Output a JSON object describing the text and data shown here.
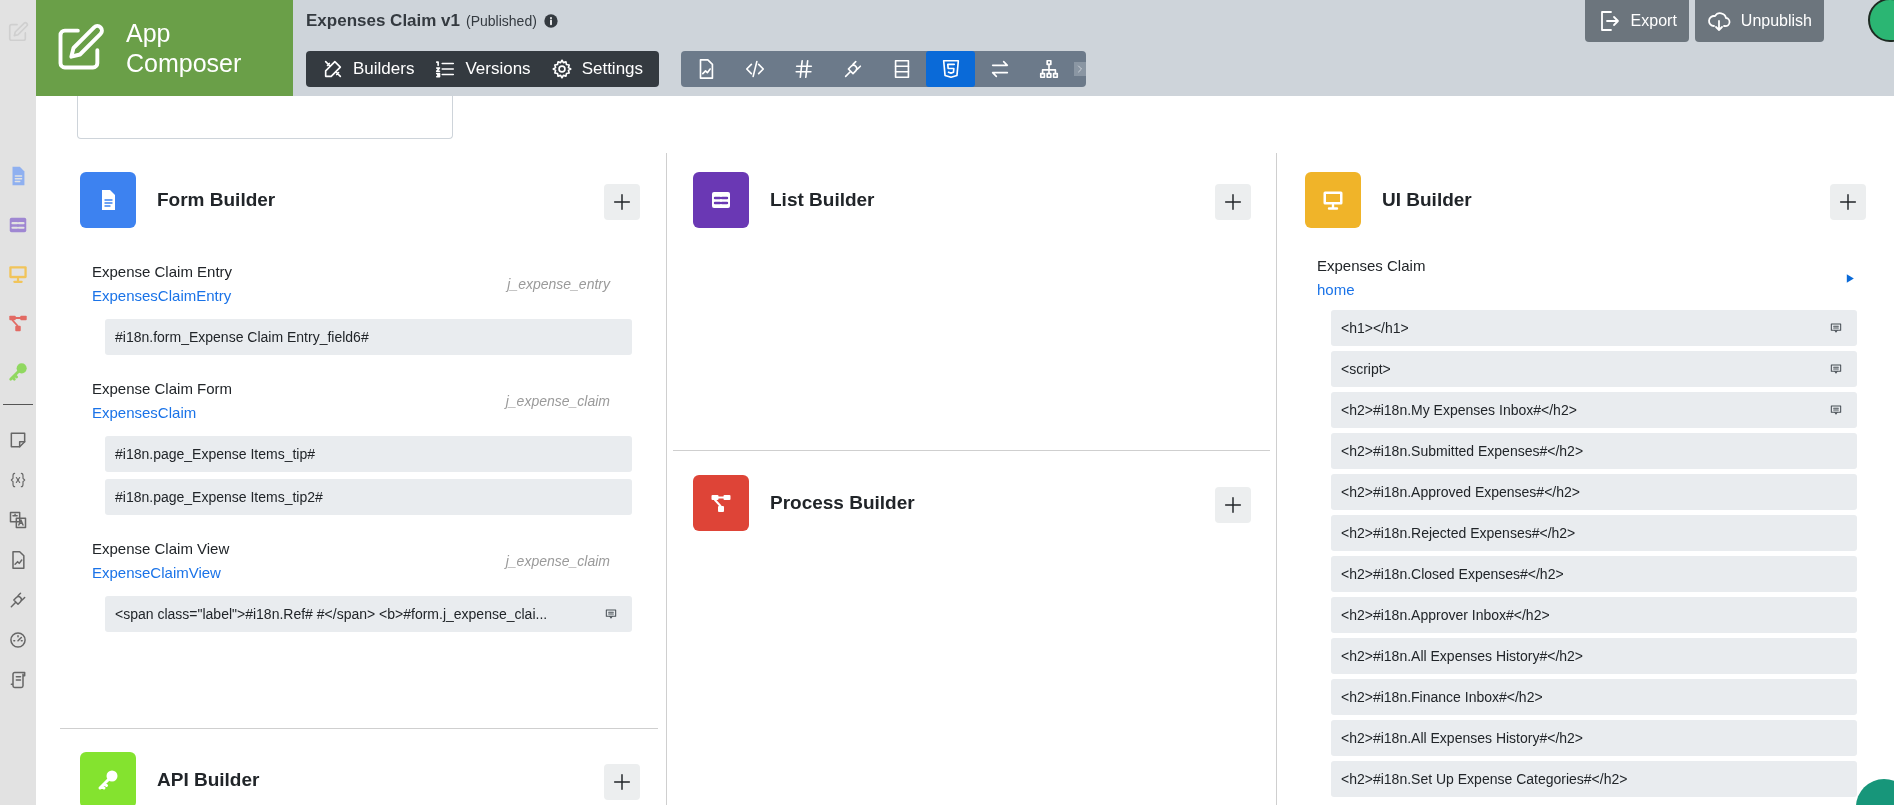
{
  "app": {
    "logo_text": "App Composer",
    "title": "Expenses Claim v1",
    "status": "(Published)"
  },
  "nav": [
    {
      "label": "Builders"
    },
    {
      "label": "Versions"
    },
    {
      "label": "Settings"
    }
  ],
  "tools": [
    {
      "selected": false
    },
    {
      "selected": false
    },
    {
      "selected": false
    },
    {
      "selected": false
    },
    {
      "selected": false
    },
    {
      "selected": true
    },
    {
      "selected": false
    },
    {
      "selected": false
    }
  ],
  "actions": [
    {
      "label": "Export"
    },
    {
      "label": "Unpublish"
    }
  ],
  "form_builder": {
    "title": "Form Builder",
    "forms": [
      {
        "name": "Expense Claim Entry",
        "id": "ExpensesClaimEntry",
        "table": "j_expense_entry",
        "fields": [
          {
            "text": "#i18n.form_Expense Claim Entry_field6#",
            "has_note": false
          }
        ]
      },
      {
        "name": "Expense Claim Form",
        "id": "ExpensesClaim",
        "table": "j_expense_claim",
        "fields": [
          {
            "text": "#i18n.page_Expense Items_tip#",
            "has_note": false
          },
          {
            "text": "#i18n.page_Expense Items_tip2#",
            "has_note": false
          }
        ]
      },
      {
        "name": "Expense Claim View",
        "id": "ExpenseClaimView",
        "table": "j_expense_claim",
        "fields": [
          {
            "text": "<span class=\"label\">#i18n.Ref# #</span> <b>#form.j_expense_clai...",
            "has_note": true
          }
        ]
      }
    ]
  },
  "list_builder": {
    "title": "List Builder"
  },
  "process_builder": {
    "title": "Process Builder"
  },
  "api_builder": {
    "title": "API Builder"
  },
  "ui_builder": {
    "title": "UI Builder",
    "userview": {
      "name": "Expenses Claim",
      "id": "home",
      "elements": [
        {
          "text": "<h1></h1>",
          "has_note": true
        },
        {
          "text": "<script>",
          "has_note": true
        },
        {
          "text": "<h2>#i18n.My Expenses Inbox#</h2>",
          "has_note": true
        },
        {
          "text": "<h2>#i18n.Submitted Expenses#</h2>",
          "has_note": false
        },
        {
          "text": "<h2>#i18n.Approved Expenses#</h2>",
          "has_note": false
        },
        {
          "text": "<h2>#i18n.Rejected Expenses#</h2>",
          "has_note": false
        },
        {
          "text": "<h2>#i18n.Closed Expenses#</h2>",
          "has_note": false
        },
        {
          "text": "<h2>#i18n.Approver Inbox#</h2>",
          "has_note": false
        },
        {
          "text": "<h2>#i18n.All Expenses History#</h2>",
          "has_note": false
        },
        {
          "text": "<h2>#i18n.Finance Inbox#</h2>",
          "has_note": false
        },
        {
          "text": "<h2>#i18n.All Expenses History#</h2>",
          "has_note": false
        },
        {
          "text": "<h2>#i18n.Set Up Expense Categories#</h2>",
          "has_note": false
        }
      ]
    }
  }
}
